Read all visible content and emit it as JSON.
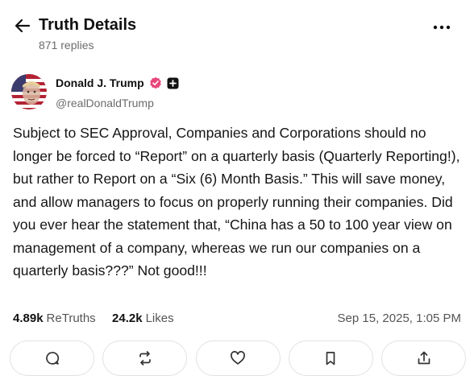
{
  "header": {
    "title": "Truth Details",
    "replies": "871 replies"
  },
  "author": {
    "name": "Donald J. Trump",
    "handle": "@realDonaldTrump"
  },
  "post": {
    "text": "Subject to SEC Approval, Companies and Corporations should no longer be forced to “Report” on a quarterly basis (Quarterly Reporting!), but rather to Report on a “Six (6) Month Basis.” This will save money, and allow managers to focus on properly running their companies. Did you ever hear the statement that, “China has a 50 to 100 year view on management of a company, whereas we run our companies on a quarterly basis???” Not good!!!"
  },
  "stats": {
    "retruths_count": "4.89k",
    "retruths_label": "ReTruths",
    "likes_count": "24.2k",
    "likes_label": "Likes",
    "timestamp": "Sep 15, 2025, 1:05 PM"
  },
  "actions": [
    {
      "name": "reply",
      "icon": "comment-icon"
    },
    {
      "name": "retruth",
      "icon": "repost-icon"
    },
    {
      "name": "like",
      "icon": "heart-icon"
    },
    {
      "name": "bookmark",
      "icon": "bookmark-icon"
    },
    {
      "name": "share",
      "icon": "share-icon"
    }
  ],
  "colors": {
    "verified": "#e8467a",
    "text": "#111111",
    "muted": "#6b6b6b",
    "border": "#e2e2e2"
  }
}
